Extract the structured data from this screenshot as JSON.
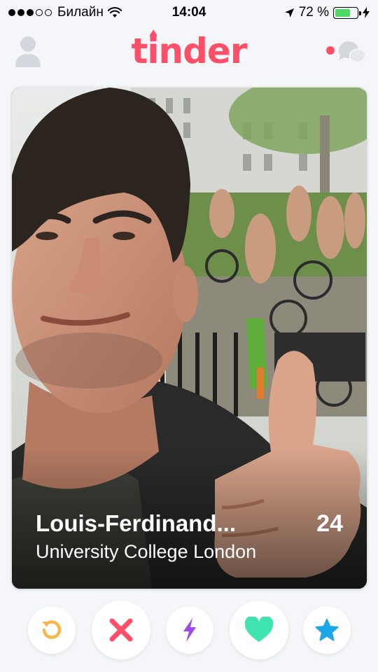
{
  "status_bar": {
    "carrier": "Билайн",
    "time": "14:04",
    "battery_percent": "72 %",
    "battery_level": 0.72,
    "signal_bars_filled": 3,
    "signal_bars_total": 5,
    "icons": [
      "wifi-icon",
      "location-arrow-icon",
      "charging-bolt-icon"
    ]
  },
  "header": {
    "logo_text": "tinder",
    "left_icon": "profile-icon",
    "right_icon": "messages-icon",
    "notification_dot": true
  },
  "card": {
    "name": "Louis-Ferdinand...",
    "age": "24",
    "school": "University College London"
  },
  "actions": [
    {
      "name": "rewind",
      "icon": "rewind-icon",
      "color": "#f5b748"
    },
    {
      "name": "nope",
      "icon": "close-icon",
      "color": "#fd5068"
    },
    {
      "name": "boost",
      "icon": "lightning-bolt-icon",
      "color": "#9d4ae8"
    },
    {
      "name": "like",
      "icon": "heart-icon",
      "color": "#3ee3b0"
    },
    {
      "name": "super-like",
      "icon": "star-icon",
      "color": "#1aa6e8"
    }
  ],
  "colors": {
    "brand": "#fd5068",
    "background": "#f4f6f9",
    "battery": "#4cd964"
  }
}
